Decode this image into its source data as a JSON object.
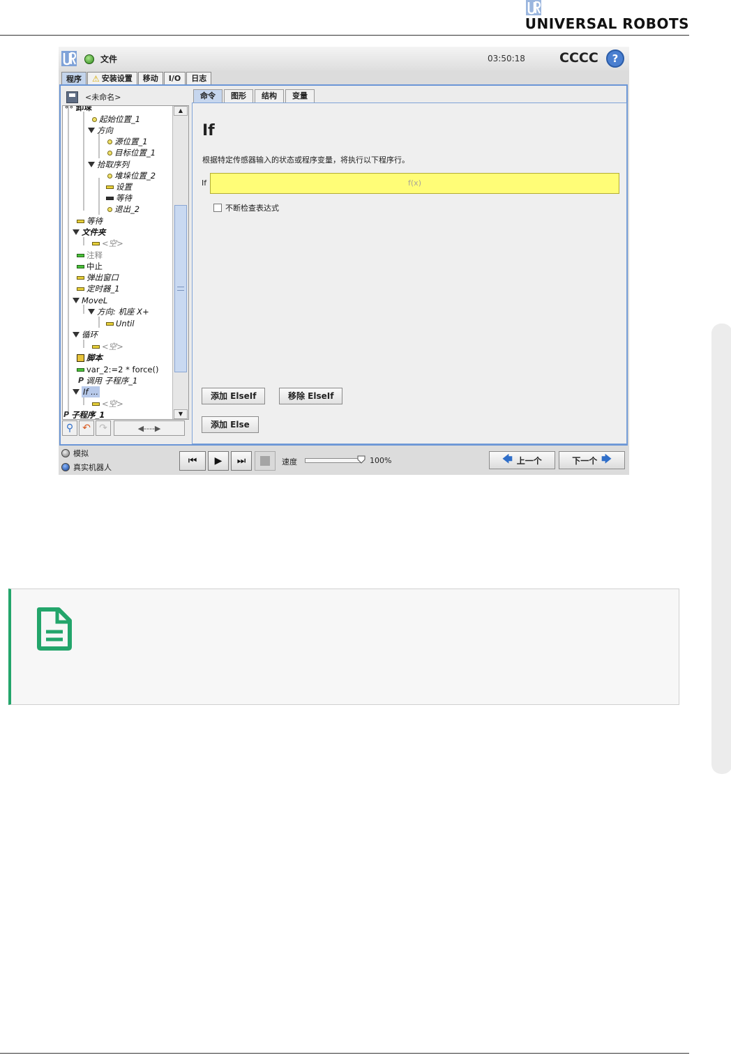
{
  "doc_header": {
    "brand": "UNIVERSAL ROBOTS"
  },
  "topbar": {
    "menu_file": "文件",
    "clock": "03:50:18",
    "robot_name": "CCCC",
    "help": "?"
  },
  "main_tabs": [
    {
      "label": "程序",
      "active": true
    },
    {
      "label": "安装设置",
      "warning": true
    },
    {
      "label": "移动"
    },
    {
      "label": "I/O"
    },
    {
      "label": "日志"
    }
  ],
  "program": {
    "title": "<未命名>"
  },
  "tree": [
    {
      "label": "卸垛",
      "icon": "pallet-icon",
      "indent": 0
    },
    {
      "label": "起始位置_1",
      "icon": "waypoint-icon",
      "indent": 2
    },
    {
      "label": "方向",
      "icon": "folder-triangle-icon",
      "indent": 1
    },
    {
      "label": "源位置_1",
      "icon": "waypoint-icon",
      "indent": 3
    },
    {
      "label": "目标位置_1",
      "icon": "waypoint-icon",
      "indent": 3
    },
    {
      "label": "拾取序列",
      "icon": "folder-triangle-icon",
      "indent": 1
    },
    {
      "label": "堆垛位置_2",
      "icon": "waypoint-icon",
      "indent": 3
    },
    {
      "label": "设置",
      "icon": "command-icon",
      "indent": 3
    },
    {
      "label": "等待",
      "icon": "command-icon",
      "indent": 3
    },
    {
      "label": "退出_2",
      "icon": "waypoint-icon",
      "indent": 3
    },
    {
      "label": "等待",
      "icon": "command-icon",
      "indent": 0
    },
    {
      "label": "文件夹",
      "icon": "folder-triangle-icon",
      "indent": 0
    },
    {
      "label": "<空>",
      "icon": "command-icon",
      "indent": 1
    },
    {
      "label": "注释",
      "icon": "command-icon",
      "indent": 0
    },
    {
      "label": "中止",
      "icon": "command-icon",
      "indent": 0
    },
    {
      "label": "弹出窗口",
      "icon": "command-icon",
      "indent": 0
    },
    {
      "label": "定时器_1",
      "icon": "command-icon",
      "indent": 0
    },
    {
      "label": "MoveL",
      "icon": "folder-triangle-icon",
      "indent": 0
    },
    {
      "label": "方向: 机座 X+",
      "icon": "folder-triangle-icon",
      "indent": 1
    },
    {
      "label": "Until",
      "icon": "command-icon",
      "indent": 2
    },
    {
      "label": "循环",
      "icon": "folder-triangle-icon",
      "indent": 0
    },
    {
      "label": "<空>",
      "icon": "command-icon",
      "indent": 1
    },
    {
      "label": "脚本",
      "icon": "script-icon",
      "indent": 0
    },
    {
      "label": "var_2:=2 * force()",
      "icon": "command-icon",
      "indent": 0
    },
    {
      "label": "调用 子程序_1",
      "icon": "call-icon",
      "indent": 0
    },
    {
      "label": "If ...",
      "icon": "folder-triangle-icon",
      "indent": 0,
      "selected": true
    },
    {
      "label": "<空>",
      "icon": "command-icon",
      "indent": 1
    },
    {
      "label": "子程序_1",
      "icon": "subprogram-icon",
      "indent": 0
    }
  ],
  "sub_tabs": [
    {
      "label": "命令",
      "active": true
    },
    {
      "label": "图形"
    },
    {
      "label": "结构"
    },
    {
      "label": "变量"
    }
  ],
  "command": {
    "title": "If",
    "description": "根据特定传感器输入的状态或程序变量，将执行以下程序行。",
    "if_label": "If",
    "expression_placeholder": "f(x)",
    "check_label": "不断检查表达式",
    "add_elseif": "添加 ElseIf",
    "remove_elseif": "移除 ElseIf",
    "add_else": "添加 Else"
  },
  "bottom": {
    "mode_sim": "模拟",
    "mode_real": "真实机器人",
    "speed_label": "速度",
    "speed_value": "100%",
    "speed_fraction": 1.0,
    "prev": "上一个",
    "next": "下一个"
  }
}
